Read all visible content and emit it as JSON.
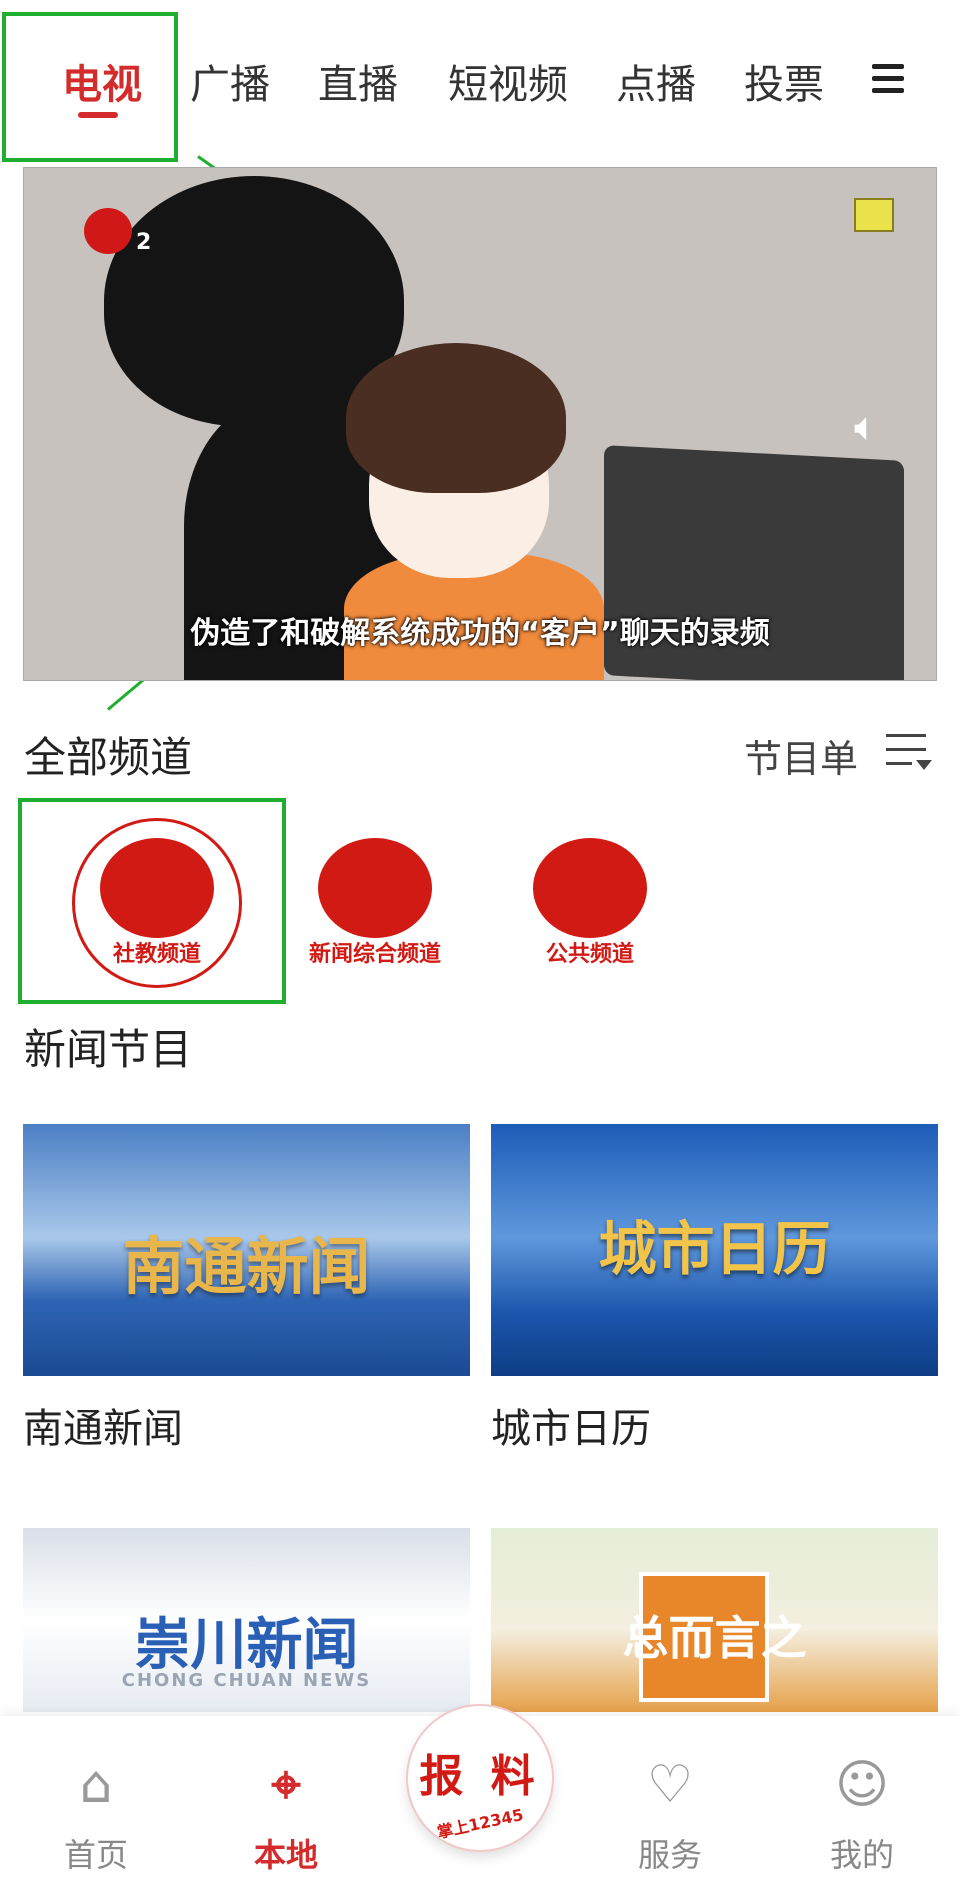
{
  "top_tabs": [
    "电视",
    "广播",
    "直播",
    "短视频",
    "点播",
    "投票"
  ],
  "video": {
    "channel_badge": "2",
    "subtitle": "伪造了和破解系统成功的“客户”聊天的录频"
  },
  "channels_section": {
    "title": "全部频道",
    "schedule_label": "节目单",
    "channels": [
      "社教频道",
      "新闻综合频道",
      "公共频道"
    ]
  },
  "news_section": {
    "title": "新闻节目",
    "programs": [
      {
        "title": "南通新闻",
        "thumb_text": "南通新闻"
      },
      {
        "title": "城市日历",
        "thumb_text": "城市日历"
      },
      {
        "thumb_text": "崇川新闻",
        "thumb_sub": "CHONG CHUAN NEWS"
      },
      {
        "thumb_text": "总而言之"
      }
    ]
  },
  "bottom_nav": {
    "home": "首页",
    "local": "本地",
    "report_main": "报 料",
    "report_sub": "掌上12345",
    "service": "服务",
    "mine": "我的"
  },
  "colors": {
    "accent": "#d42c2c",
    "annotation": "#1fae2f"
  },
  "icons": [
    "menu-icon",
    "sound-icon",
    "playlist-icon",
    "home-icon",
    "location-icon",
    "heart-icon",
    "user-icon"
  ]
}
